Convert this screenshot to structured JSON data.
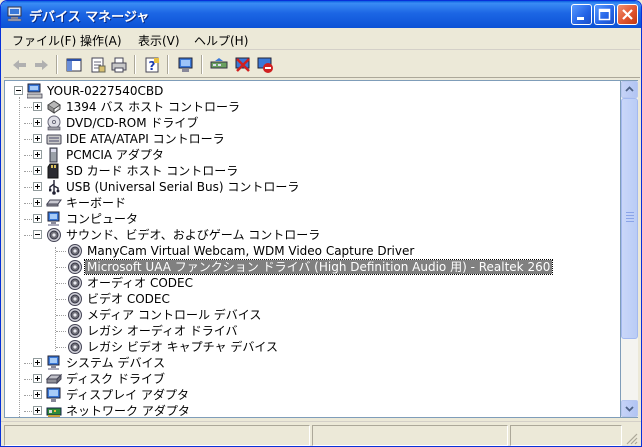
{
  "window": {
    "title": "デバイス マネージャ"
  },
  "menu": [
    "ファイル(F)",
    "操作(A)",
    "表示(V)",
    "ヘルプ(H)"
  ],
  "toolbar": [
    {
      "name": "back-arrow-icon"
    },
    {
      "name": "forward-arrow-icon"
    },
    {
      "name": "show-hide-tree-icon"
    },
    {
      "name": "properties-icon"
    },
    {
      "name": "print-icon"
    },
    {
      "name": "help-icon"
    },
    {
      "name": "scan-hardware-icon"
    },
    {
      "name": "update-driver-icon"
    },
    {
      "name": "disable-device-icon"
    },
    {
      "name": "uninstall-device-icon"
    }
  ],
  "tree": {
    "root": "YOUR-0227540CBD",
    "categories": [
      "1394 バス ホスト コントローラ",
      "DVD/CD-ROM ドライブ",
      "IDE ATA/ATAPI コントローラ",
      "PCMCIA アダプタ",
      "SD カード ホスト コントローラ",
      "USB (Universal Serial Bus) コントローラ",
      "キーボード",
      "コンピュータ",
      "サウンド、ビデオ、およびゲーム コントローラ"
    ],
    "sound_children": [
      "ManyCam Virtual Webcam, WDM Video Capture Driver",
      "Microsoft UAA ファンクション ドライバ (High Definition Audio 用) - Realtek 260",
      "オーディオ CODEC",
      "ビデオ CODEC",
      "メディア コントロール デバイス",
      "レガシ オーディオ ドライバ",
      "レガシ ビデオ キャプチャ デバイス"
    ],
    "categories_after": [
      "システム デバイス",
      "ディスク ドライブ",
      "ディスプレイ アダプタ",
      "ネットワーク アダプタ"
    ]
  },
  "colors": {
    "titlebar": "#0b52d6",
    "selection": "#808080",
    "window_bg": "#ece9d8"
  }
}
